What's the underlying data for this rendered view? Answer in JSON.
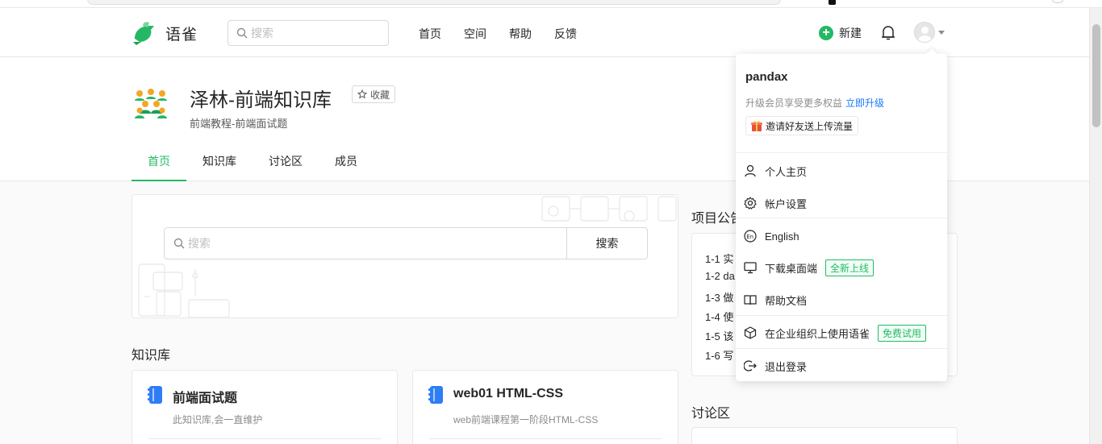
{
  "header": {
    "logo_text": "语雀",
    "search_placeholder": "搜索",
    "nav": [
      "首页",
      "空间",
      "帮助",
      "反馈"
    ],
    "new_label": "新建"
  },
  "book": {
    "title": "泽林-前端知识库",
    "collect_label": "收藏",
    "description": "前端教程-前端面试题",
    "tabs": [
      "首页",
      "知识库",
      "讨论区",
      "成员"
    ],
    "active_tab": "首页"
  },
  "search_panel": {
    "placeholder": "搜索",
    "button": "搜索"
  },
  "knowledge": {
    "title": "知识库",
    "cards": [
      {
        "title": "前端面试题",
        "desc": "此知识库,会一直维护"
      },
      {
        "title": "web01 HTML-CSS",
        "desc": "web前端课程第一阶段HTML-CSS"
      }
    ]
  },
  "notice": {
    "title": "项目公告",
    "items": [
      "1-1 实",
      "1-2 da",
      "1-3 做",
      "1-4 使",
      "1-5 该",
      "1-6 写"
    ]
  },
  "discuss": {
    "title": "讨论区"
  },
  "dropdown": {
    "username": "pandax",
    "upgrade_text": "升级会员享受更多权益",
    "upgrade_link": "立即升级",
    "invite": "邀请好友送上传流量",
    "items": {
      "profile": "个人主页",
      "settings": "帐户设置",
      "english": "English",
      "download": "下载桌面端",
      "download_tag": "全新上线",
      "help": "帮助文档",
      "enterprise": "在企业组织上使用语雀",
      "enterprise_tag": "免费试用",
      "logout": "退出登录"
    }
  },
  "colors": {
    "brand": "#25b864",
    "link": "#1677ff",
    "book_icon_blue": "#2f7df6"
  }
}
